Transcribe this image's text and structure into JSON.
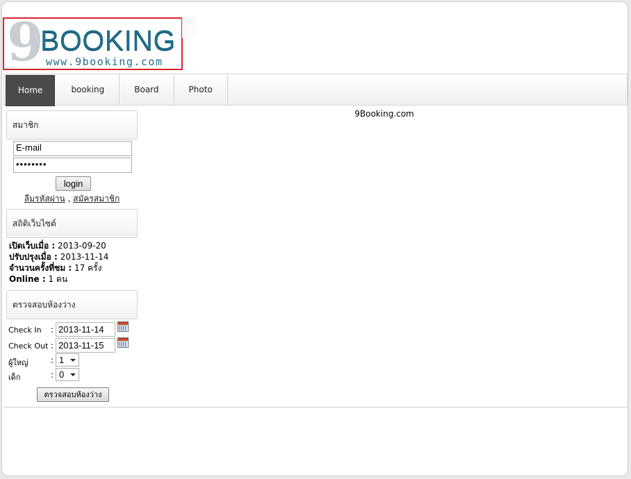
{
  "logo": {
    "numeral": "9",
    "word": "BOOKING",
    "url": "www.9booking.com"
  },
  "nav": {
    "tabs": [
      {
        "label": "Home",
        "active": true
      },
      {
        "label": "booking",
        "active": false
      },
      {
        "label": "Board",
        "active": false
      },
      {
        "label": "Photo",
        "active": false
      }
    ]
  },
  "main": {
    "site_title": "9Booking.com"
  },
  "member": {
    "heading": "สมาชิก",
    "email_value": "E-mail",
    "password_value": "••••••••",
    "login_label": "login",
    "forgot_label": "ลืมรหัสผ่าน",
    "separator": ",",
    "register_label": "สมัครสมาชิก"
  },
  "stats": {
    "heading": "สถิติเว็บไซต์",
    "opened_label": "เปิดเว็บเมื่อ :",
    "opened_value": "2013-09-20",
    "updated_label": "ปรับปรุงเมื่อ :",
    "updated_value": "2013-11-14",
    "visits_label": "จำนวนครั้งที่ชม :",
    "visits_value": "17 ครั้ง",
    "online_label": "Online :",
    "online_value": "1 คน"
  },
  "availability": {
    "heading": "ตรวจสอบห้องว่าง",
    "checkin_label": "Check In",
    "checkin_value": "2013-11-14",
    "checkout_label": "Check Out",
    "checkout_value": "2013-11-15",
    "adults_label": "ผู้ใหญ่",
    "adults_value": "1",
    "children_label": "เด็ก",
    "children_value": "0",
    "colon": ":",
    "submit_label": "ตรวจสอบห้องว่าง",
    "icon": "calendar-icon"
  },
  "colors": {
    "brand": "#1f6e8c",
    "logo_border": "#d8232a",
    "active_tab": "#4b4b4b"
  }
}
